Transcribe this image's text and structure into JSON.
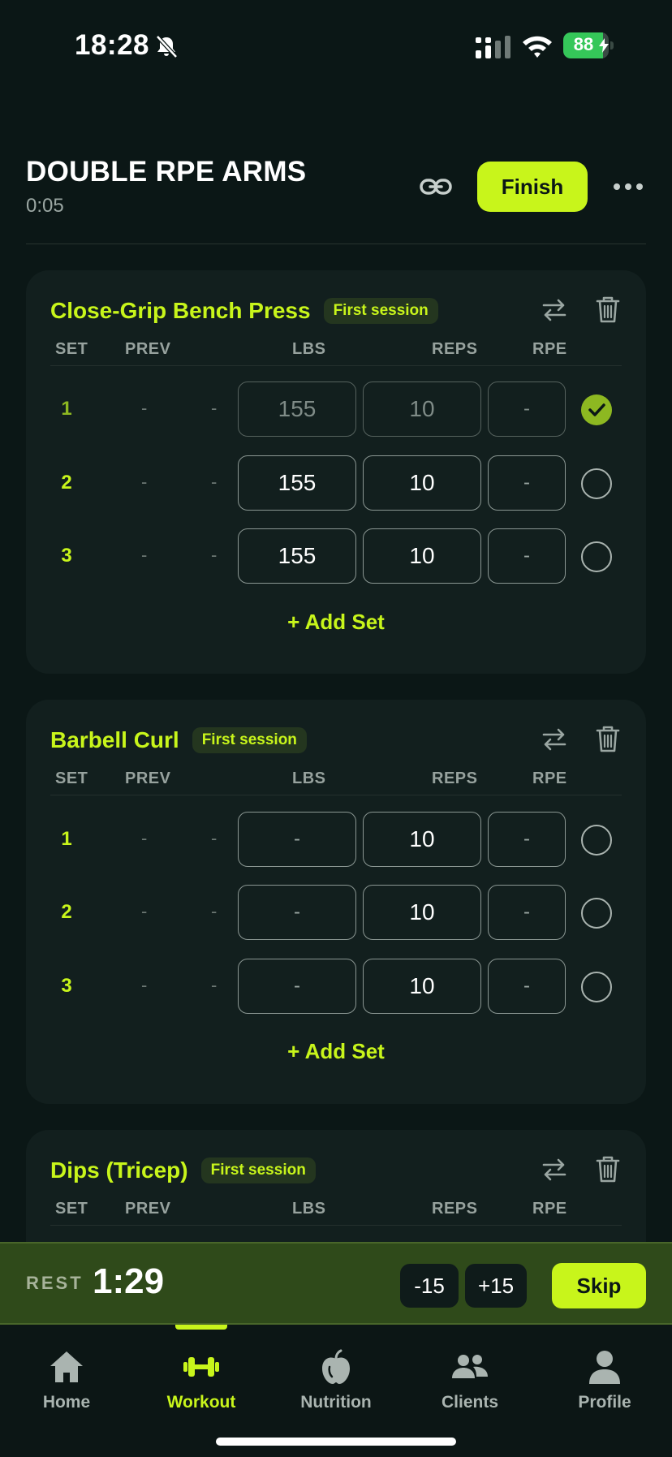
{
  "status_bar": {
    "time": "18:28",
    "battery": "88",
    "battery_level": 0.88
  },
  "header": {
    "title": "DOUBLE RPE ARMS",
    "timer": "0:05",
    "finish_label": "Finish"
  },
  "columns": {
    "set": "SET",
    "prev": "PREV",
    "weight": "LBS",
    "reps": "REPS",
    "rpe": "RPE"
  },
  "exercises": [
    {
      "name": "Close-Grip Bench Press",
      "badge": "First session",
      "sets": [
        {
          "num": "1",
          "prev": "-",
          "prev2": "-",
          "weight": "155",
          "reps": "10",
          "rpe": "-",
          "done": true
        },
        {
          "num": "2",
          "prev": "-",
          "prev2": "-",
          "weight": "155",
          "reps": "10",
          "rpe": "-",
          "done": false
        },
        {
          "num": "3",
          "prev": "-",
          "prev2": "-",
          "weight": "155",
          "reps": "10",
          "rpe": "-",
          "done": false
        }
      ],
      "add_set_label": "Add Set"
    },
    {
      "name": "Barbell Curl",
      "badge": "First session",
      "sets": [
        {
          "num": "1",
          "prev": "-",
          "prev2": "-",
          "weight": "-",
          "reps": "10",
          "rpe": "-",
          "done": false
        },
        {
          "num": "2",
          "prev": "-",
          "prev2": "-",
          "weight": "-",
          "reps": "10",
          "rpe": "-",
          "done": false
        },
        {
          "num": "3",
          "prev": "-",
          "prev2": "-",
          "weight": "-",
          "reps": "10",
          "rpe": "-",
          "done": false
        }
      ],
      "add_set_label": "Add Set"
    },
    {
      "name": "Dips (Tricep)",
      "badge": "First session"
    }
  ],
  "rest": {
    "label": "REST",
    "time": "1:29",
    "minus_label": "-15",
    "plus_label": "+15",
    "skip_label": "Skip"
  },
  "tabs": [
    {
      "label": "Home",
      "icon": "home-icon"
    },
    {
      "label": "Workout",
      "icon": "dumbbell-icon",
      "active": true
    },
    {
      "label": "Nutrition",
      "icon": "apple-icon"
    },
    {
      "label": "Clients",
      "icon": "clients-icon"
    },
    {
      "label": "Profile",
      "icon": "profile-icon"
    }
  ],
  "colors": {
    "accent": "#c8f51b",
    "background": "#0b1716",
    "card": "#121f1e",
    "rest_bar": "#2f4a1a"
  }
}
